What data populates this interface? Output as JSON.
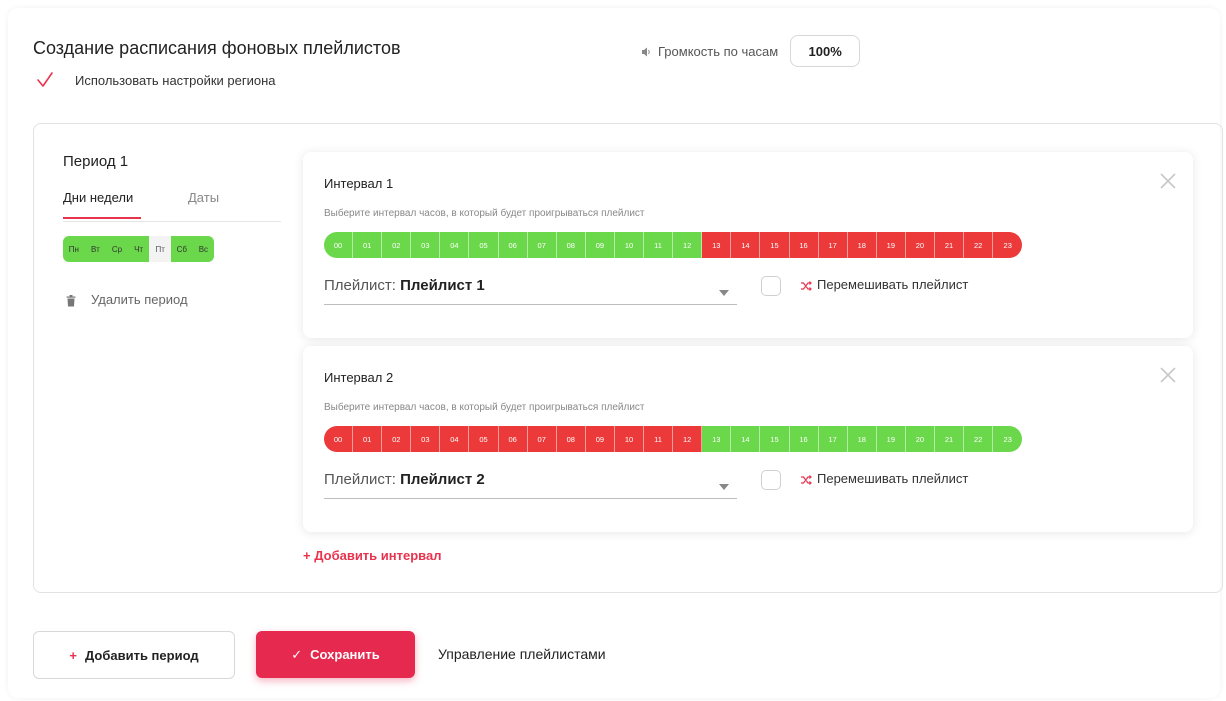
{
  "header": {
    "title": "Создание расписания фоновых плейлистов",
    "use_region_label": "Использовать настройки региона",
    "use_region_checked": true,
    "volume_label": "Громкость по часам",
    "volume_value": "100%"
  },
  "period": {
    "title": "Период 1",
    "tabs": [
      {
        "label": "Дни недели",
        "active": true
      },
      {
        "label": "Даты",
        "active": false
      }
    ],
    "days": [
      {
        "label": "Пн",
        "on": true
      },
      {
        "label": "Вт",
        "on": true
      },
      {
        "label": "Ср",
        "on": true
      },
      {
        "label": "Чт",
        "on": true
      },
      {
        "label": "Пт",
        "on": false
      },
      {
        "label": "Сб",
        "on": true
      },
      {
        "label": "Вс",
        "on": true
      }
    ],
    "delete_label": "Удалить период"
  },
  "intervals": [
    {
      "title": "Интервал 1",
      "hint": "Выберите интервал часов, в который будет проигрываться плейлист",
      "hours": [
        "00",
        "01",
        "02",
        "03",
        "04",
        "05",
        "06",
        "07",
        "08",
        "09",
        "10",
        "11",
        "12",
        "13",
        "14",
        "15",
        "16",
        "17",
        "18",
        "19",
        "20",
        "21",
        "22",
        "23"
      ],
      "hour_states": [
        "g",
        "g",
        "g",
        "g",
        "g",
        "g",
        "g",
        "g",
        "g",
        "g",
        "g",
        "g",
        "g",
        "r",
        "r",
        "r",
        "r",
        "r",
        "r",
        "r",
        "r",
        "r",
        "r",
        "r"
      ],
      "playlist_prefix": "Плейлист:",
      "playlist_name": "Плейлист 1",
      "shuffle_label": "Перемешивать плейлист",
      "shuffle_checked": false
    },
    {
      "title": "Интервал 2",
      "hint": "Выберите интервал часов, в который будет проигрываться плейлист",
      "hours": [
        "00",
        "01",
        "02",
        "03",
        "04",
        "05",
        "06",
        "07",
        "08",
        "09",
        "10",
        "11",
        "12",
        "13",
        "14",
        "15",
        "16",
        "17",
        "18",
        "19",
        "20",
        "21",
        "22",
        "23"
      ],
      "hour_states": [
        "r",
        "r",
        "r",
        "r",
        "r",
        "r",
        "r",
        "r",
        "r",
        "r",
        "r",
        "r",
        "r",
        "g",
        "g",
        "g",
        "g",
        "g",
        "g",
        "g",
        "g",
        "g",
        "g",
        "g"
      ],
      "playlist_prefix": "Плейлист:",
      "playlist_name": "Плейлист 2",
      "shuffle_label": "Перемешивать плейлист",
      "shuffle_checked": false
    }
  ],
  "add_interval_label": "+ Добавить интервал",
  "footer": {
    "add_period_plus": "+",
    "add_period_label": "Добавить период",
    "save_check": "✓",
    "save_label": "Сохранить",
    "manage_label": "Управление плейлистами"
  },
  "colors": {
    "accent": "#e6294f",
    "green": "#6ad84a",
    "red": "#ec3a3a"
  }
}
